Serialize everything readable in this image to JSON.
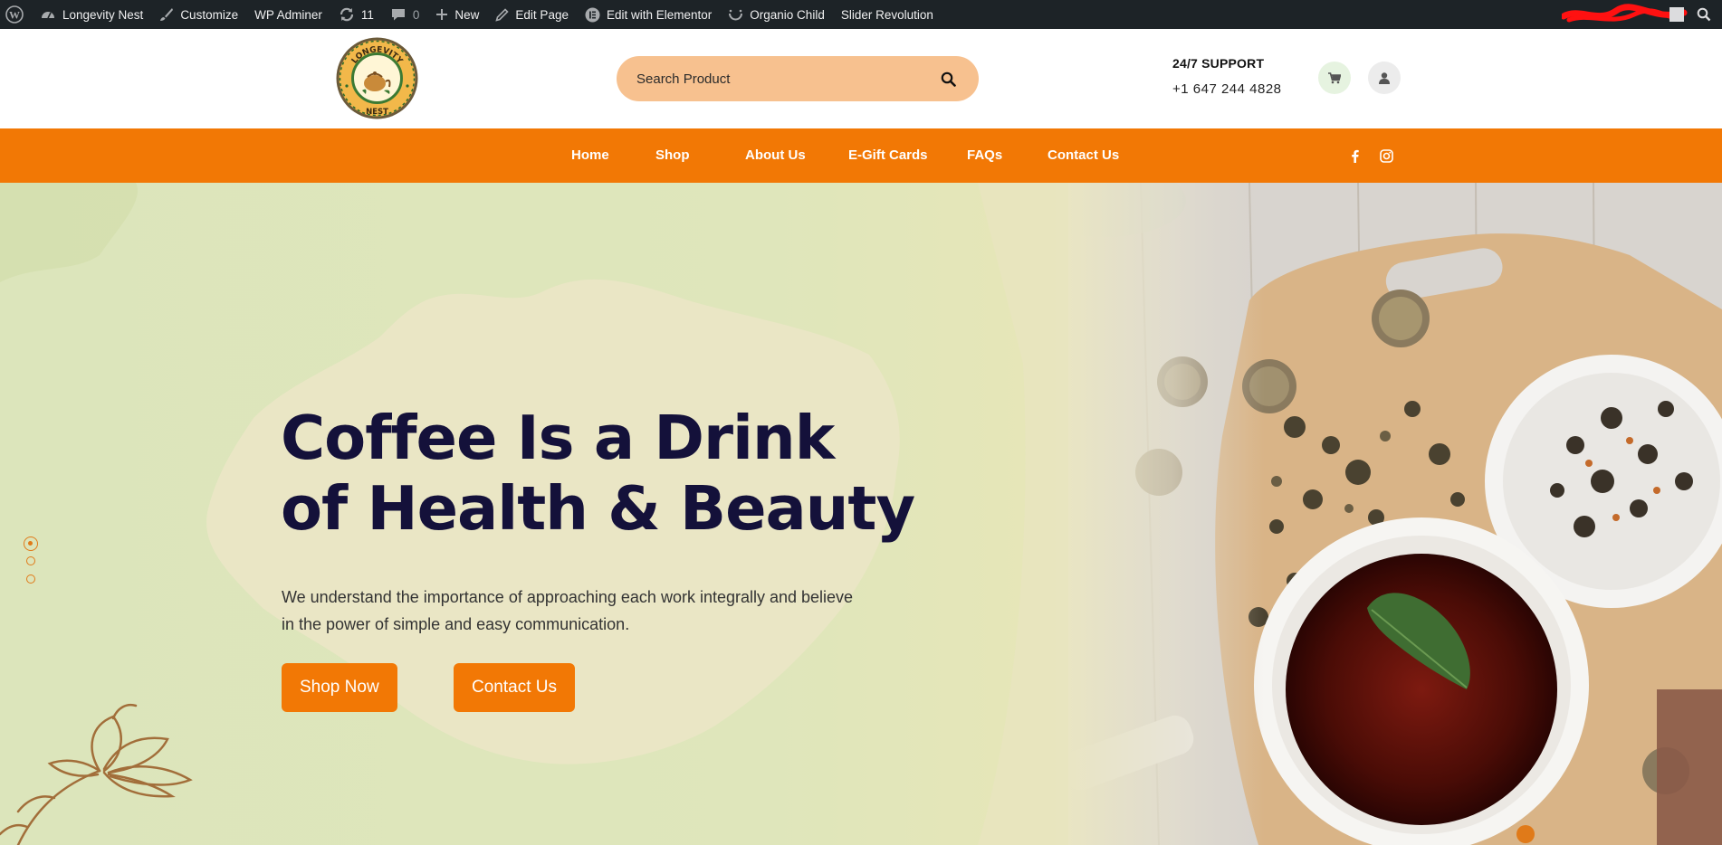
{
  "admin_bar": {
    "site_name": "Longevity Nest",
    "customize": "Customize",
    "wp_adminer": "WP Adminer",
    "updates_count": "11",
    "comments_count": "0",
    "new": "New",
    "edit_page": "Edit Page",
    "edit_elementor": "Edit with Elementor",
    "organio_child": "Organio Child",
    "slider_revolution": "Slider Revolution"
  },
  "header": {
    "logo_text_top": "LONGEVITY",
    "logo_text_bottom": "NEST",
    "search_placeholder": "Search Product",
    "support_title": "24/7 SUPPORT",
    "support_phone": "+1 647 244 4828"
  },
  "nav": {
    "items": [
      {
        "label": "Home"
      },
      {
        "label": "Shop"
      },
      {
        "label": "About Us"
      },
      {
        "label": "E-Gift Cards"
      },
      {
        "label": "FAQs"
      },
      {
        "label": "Contact Us"
      }
    ]
  },
  "hero": {
    "title_line1": "Coffee Is a Drink",
    "title_line2": "of Health & Beauty",
    "desc_line1": "We understand the importance of approaching each work integrally and believe",
    "desc_line2": "in the power of simple and easy communication.",
    "shop_button": "Shop Now",
    "contact_button": "Contact Us",
    "slides_total": 3,
    "active_slide": 1
  },
  "colors": {
    "admin_bar_bg": "#1d2327",
    "accent_orange": "#f27805",
    "search_bg": "#f7c18f",
    "title_color": "#14113a"
  },
  "icons": [
    "wordpress-icon",
    "dashboard-icon",
    "brush-icon",
    "refresh-icon",
    "comment-icon",
    "plus-icon",
    "pencil-icon",
    "elementor-icon",
    "theme-icon",
    "search-icon",
    "cart-icon",
    "user-icon",
    "facebook-icon",
    "instagram-icon"
  ]
}
